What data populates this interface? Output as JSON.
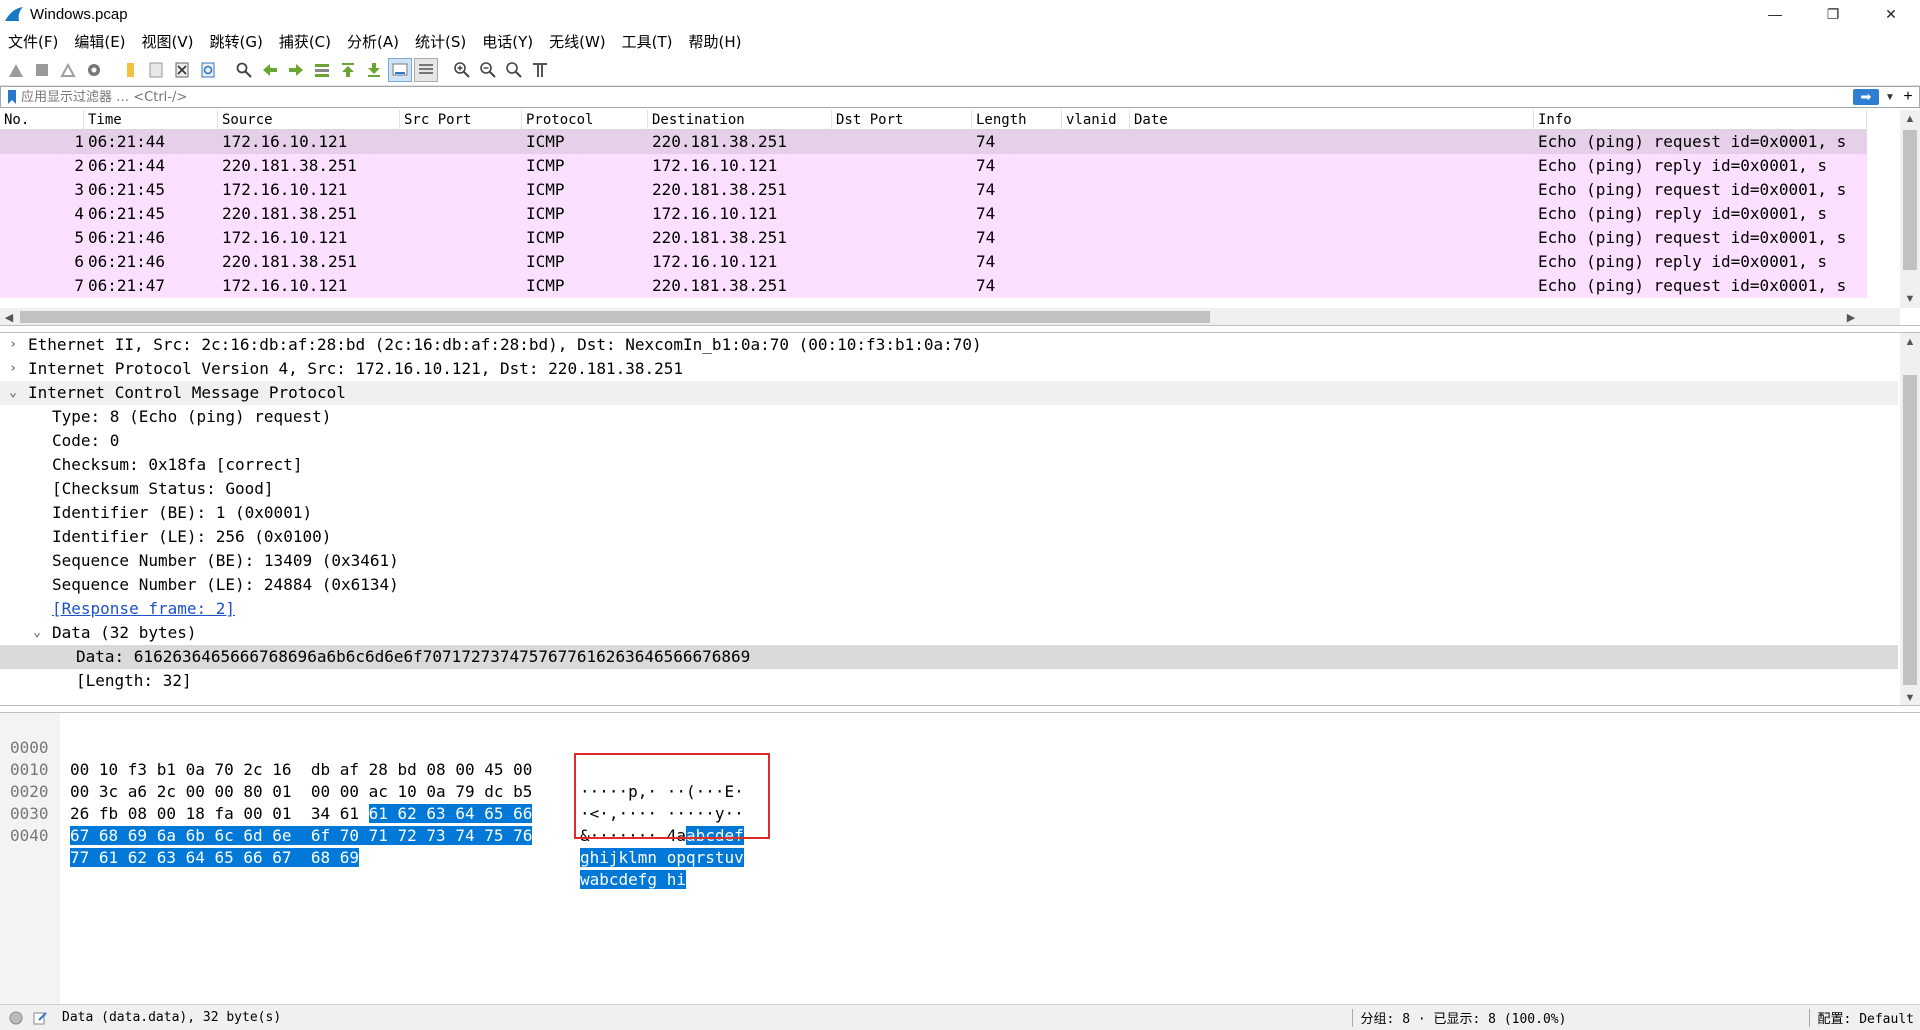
{
  "window": {
    "title": "Windows.pcap",
    "controls": [
      "—",
      "❐",
      "✕"
    ]
  },
  "menu": [
    "文件(F)",
    "编辑(E)",
    "视图(V)",
    "跳转(G)",
    "捕获(C)",
    "分析(A)",
    "统计(S)",
    "电话(Y)",
    "无线(W)",
    "工具(T)",
    "帮助(H)"
  ],
  "toolbar": {
    "icons": [
      "start-capture-icon",
      "stop-capture-icon",
      "restart-capture-icon",
      "capture-options-icon",
      "open-file-icon",
      "save-file-icon",
      "close-file-icon",
      "reload-file-icon",
      "find-packet-icon",
      "go-back-icon",
      "go-forward-icon",
      "go-to-packet-icon",
      "first-packet-icon",
      "last-packet-icon",
      "auto-scroll-icon",
      "colorize-icon",
      "zoom-in-icon",
      "zoom-out-icon",
      "normal-size-icon",
      "resize-columns-icon"
    ]
  },
  "filter": {
    "placeholder": "应用显示过滤器 … <Ctrl-/>",
    "apply_arrow": "➡",
    "plus": "+"
  },
  "packet_list": {
    "columns": [
      "No.",
      "Time",
      "Source",
      "Src Port",
      "Protocol",
      "Destination",
      "Dst Port",
      "Length",
      "vlanid",
      "Date",
      "Info"
    ],
    "rows": [
      {
        "no": "1",
        "time": "06:21:44",
        "src": "172.16.10.121",
        "sport": "",
        "proto": "ICMP",
        "dst": "220.181.38.251",
        "dport": "",
        "len": "74",
        "vlan": "",
        "date": "",
        "info": "Echo (ping) request  id=0x0001, s"
      },
      {
        "no": "2",
        "time": "06:21:44",
        "src": "220.181.38.251",
        "sport": "",
        "proto": "ICMP",
        "dst": "172.16.10.121",
        "dport": "",
        "len": "74",
        "vlan": "",
        "date": "",
        "info": "Echo (ping) reply    id=0x0001, s"
      },
      {
        "no": "3",
        "time": "06:21:45",
        "src": "172.16.10.121",
        "sport": "",
        "proto": "ICMP",
        "dst": "220.181.38.251",
        "dport": "",
        "len": "74",
        "vlan": "",
        "date": "",
        "info": "Echo (ping) request  id=0x0001, s"
      },
      {
        "no": "4",
        "time": "06:21:45",
        "src": "220.181.38.251",
        "sport": "",
        "proto": "ICMP",
        "dst": "172.16.10.121",
        "dport": "",
        "len": "74",
        "vlan": "",
        "date": "",
        "info": "Echo (ping) reply    id=0x0001, s"
      },
      {
        "no": "5",
        "time": "06:21:46",
        "src": "172.16.10.121",
        "sport": "",
        "proto": "ICMP",
        "dst": "220.181.38.251",
        "dport": "",
        "len": "74",
        "vlan": "",
        "date": "",
        "info": "Echo (ping) request  id=0x0001, s"
      },
      {
        "no": "6",
        "time": "06:21:46",
        "src": "220.181.38.251",
        "sport": "",
        "proto": "ICMP",
        "dst": "172.16.10.121",
        "dport": "",
        "len": "74",
        "vlan": "",
        "date": "",
        "info": "Echo (ping) reply    id=0x0001, s"
      },
      {
        "no": "7",
        "time": "06:21:47",
        "src": "172.16.10.121",
        "sport": "",
        "proto": "ICMP",
        "dst": "220.181.38.251",
        "dport": "",
        "len": "74",
        "vlan": "",
        "date": "",
        "info": "Echo (ping) request  id=0x0001, s"
      }
    ]
  },
  "details": {
    "ethernet": "Ethernet II, Src: 2c:16:db:af:28:bd (2c:16:db:af:28:bd), Dst: NexcomIn_b1:0a:70 (00:10:f3:b1:0a:70)",
    "ip": "Internet Protocol Version 4, Src: 172.16.10.121, Dst: 220.181.38.251",
    "icmp": "Internet Control Message Protocol",
    "type": "Type: 8 (Echo (ping) request)",
    "code": "Code: 0",
    "checksum": "Checksum: 0x18fa [correct]",
    "checksum_status": "[Checksum Status: Good]",
    "id_be": "Identifier (BE): 1 (0x0001)",
    "id_le": "Identifier (LE): 256 (0x0100)",
    "seq_be": "Sequence Number (BE): 13409 (0x3461)",
    "seq_le": "Sequence Number (LE): 24884 (0x6134)",
    "response_frame": "[Response frame: 2]",
    "data_tree": "Data (32 bytes)",
    "data_value": "Data: 6162636465666768696a6b6c6d6e6f7071727374757677616263646566676869",
    "length": "[Length: 32]",
    "tree_expanded": "⌄",
    "tree_collapsed": "›"
  },
  "bytes": {
    "rows": [
      {
        "off": "0000",
        "hex_a": "00 10 f3 b1 0a 70 2c 16  db af 28 bd 08 00 45 00",
        "hex_sel": "",
        "asc_a": "·····p,· ··(···E·",
        "asc_sel": ""
      },
      {
        "off": "0010",
        "hex_a": "00 3c a6 2c 00 00 80 01  00 00 ac 10 0a 79 dc b5",
        "hex_sel": "",
        "asc_a": "·<·,···· ·····y··",
        "asc_sel": ""
      },
      {
        "off": "0020",
        "hex_a": "26 fb 08 00 18 fa 00 01  34 61 ",
        "hex_sel": "61 62 63 64 65 66",
        "asc_a": "&······· 4a",
        "asc_sel": "abcdef"
      },
      {
        "off": "0030",
        "hex_a": "",
        "hex_sel": "67 68 69 6a 6b 6c 6d 6e  6f 70 71 72 73 74 75 76",
        "asc_a": "",
        "asc_sel": "ghijklmn opqrstuv"
      },
      {
        "off": "0040",
        "hex_a": "",
        "hex_sel": "77 61 62 63 64 65 66 67  68 69",
        "asc_a": "",
        "asc_sel": "wabcdefg hi"
      }
    ]
  },
  "status": {
    "field": "Data (data.data), 32 byte(s)",
    "packets": "分组: 8 · 已显示: 8 (100.0%)",
    "profile": "配置: Default"
  },
  "colors": {
    "row_bg": "#fce0ff",
    "row_selected": "#e6cfe8",
    "byte_selection": "#0078d7",
    "annotation_box": "#e12b2b"
  }
}
